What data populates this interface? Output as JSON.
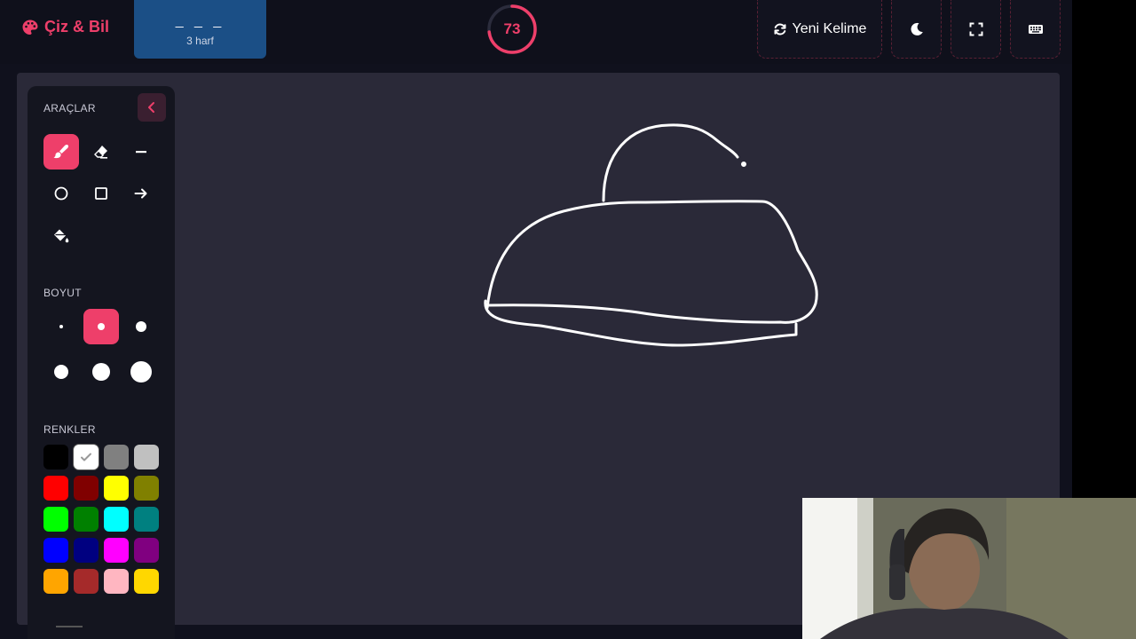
{
  "header": {
    "app_title": "Çiz & Bil",
    "word_mask": "_ _ _",
    "word_letters": "3 harf",
    "timer_value": "73",
    "timer_fraction": 0.73,
    "new_word_label": "Yeni Kelime",
    "icons": [
      "palette-icon",
      "refresh-icon",
      "moon-icon",
      "fullscreen-icon",
      "keyboard-icon"
    ]
  },
  "tools_panel": {
    "tools_title": "ARAÇLAR",
    "size_title": "BOYUT",
    "colors_title": "RENKLER",
    "tools": [
      {
        "name": "brush",
        "icon": "brush-icon",
        "active": true
      },
      {
        "name": "eraser",
        "icon": "eraser-icon",
        "active": false
      },
      {
        "name": "line",
        "icon": "line-icon",
        "active": false
      },
      {
        "name": "circle",
        "icon": "circle-icon",
        "active": false
      },
      {
        "name": "rectangle",
        "icon": "square-icon",
        "active": false
      },
      {
        "name": "arrow",
        "icon": "arrow-right-icon",
        "active": false
      },
      {
        "name": "fill",
        "icon": "fill-bucket-icon",
        "active": false
      }
    ],
    "selected_size_index": 1,
    "colors": [
      "#000000",
      "#ffffff",
      "#808080",
      "#c0c0c0",
      "#ff0000",
      "#800000",
      "#ffff00",
      "#808000",
      "#00ff00",
      "#008000",
      "#00ffff",
      "#008080",
      "#0000ff",
      "#000080",
      "#ff00ff",
      "#800080",
      "#ffa500",
      "#a52a2a",
      "#ffb6c1",
      "#ffd700"
    ],
    "selected_color": "#ffffff"
  },
  "theme": {
    "accent": "#ee3f6a",
    "canvas_bg": "#2a2938",
    "word_box_bg": "#1b4f86"
  }
}
